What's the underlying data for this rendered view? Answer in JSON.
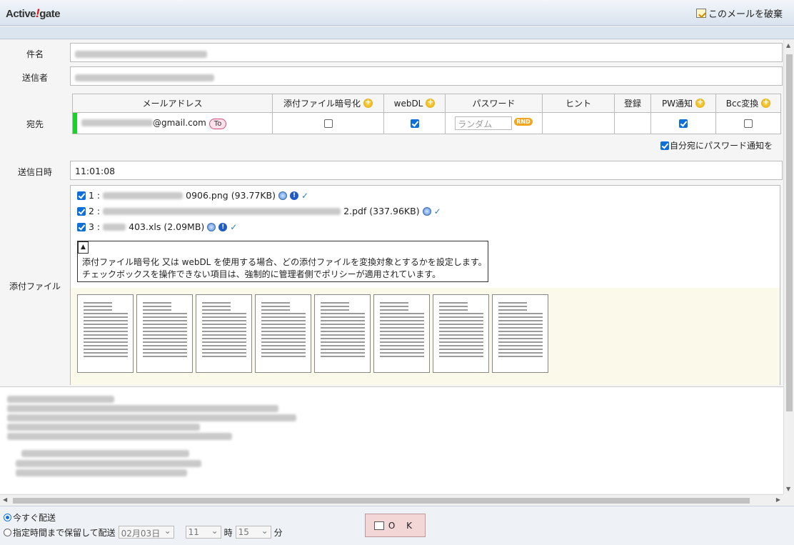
{
  "app": {
    "logo_pre": "Active",
    "logo_bang": "!",
    "logo_post": "gate",
    "discard_label": "このメールを破棄"
  },
  "form": {
    "subject_label": "件名",
    "sender_label": "送信者",
    "to_label": "宛先",
    "sent_time_label": "送信日時",
    "sent_time_value": "11:01:08",
    "attach_label": "添付ファイル"
  },
  "recipients": {
    "headers": {
      "address": "メールアドレス",
      "encrypt": "添付ファイル暗号化",
      "webdl": "webDL",
      "password": "パスワード",
      "hint": "ヒント",
      "register": "登録",
      "pw_notify": "PW通知",
      "bcc": "Bcc変換"
    },
    "row": {
      "address_suffix": "@gmail.com",
      "type_badge": "To",
      "encrypt_checked": false,
      "webdl_checked": true,
      "password_placeholder": "ランダム",
      "rnd_label": "RND",
      "pw_notify_checked": true,
      "bcc_checked": false
    },
    "self_pw_notify_label": "自分宛にパスワード通知を",
    "self_pw_notify_checked": true
  },
  "attachments": [
    {
      "index": "1 :",
      "name_suffix": "0906.png (93.77KB)"
    },
    {
      "index": "2 :",
      "name_suffix": "2.pdf (337.96KB)"
    },
    {
      "index": "3 :",
      "name_suffix": "403.xls (2.09MB)"
    }
  ],
  "tooltip": {
    "toggle_label": "▲",
    "line1": "添付ファイル暗号化 又は webDL を使用する場合、どの添付ファイルを変換対象とするかを設定します。",
    "line2": "チェックボックスを操作できない項目は、強制的に管理者側でポリシーが適用されています。"
  },
  "footer": {
    "send_now_label": "今すぐ配送",
    "send_now_selected": true,
    "hold_label": "指定時間まで保留して配送",
    "date_value": "02月03日",
    "hour_value": "11",
    "hour_unit": "時",
    "minute_value": "15",
    "minute_unit": "分",
    "ok_label": "O K"
  },
  "colors": {
    "accent": "#0f6fd8",
    "recipient_bar": "#19d12a",
    "ok_button": "#f3d6d6",
    "thumbnail_bg": "#fbfaea"
  }
}
